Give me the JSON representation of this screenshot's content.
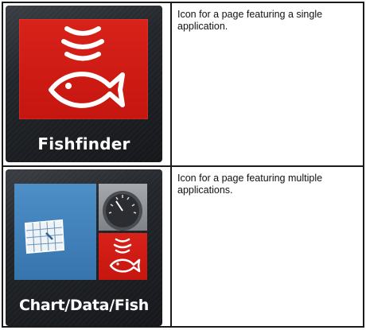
{
  "rows": [
    {
      "icon": {
        "label": "Fishfinder",
        "icon_name": "fishfinder-icon",
        "tile_colors": {
          "fishfinder": "#cc1a12",
          "background": "#202327",
          "glyph": "#ffffff"
        }
      },
      "description": "Icon for a page featuring a single application."
    },
    {
      "icon": {
        "label": "Chart/Data/Fish",
        "icon_name": "chart-data-fish-icon",
        "tile_colors": {
          "chart": "#3f7fbb",
          "gauge": "#95989c",
          "fishfinder": "#cc1a12",
          "glyph": "#ffffff"
        }
      },
      "description": "Icon for a page featuring multiple applications."
    }
  ]
}
